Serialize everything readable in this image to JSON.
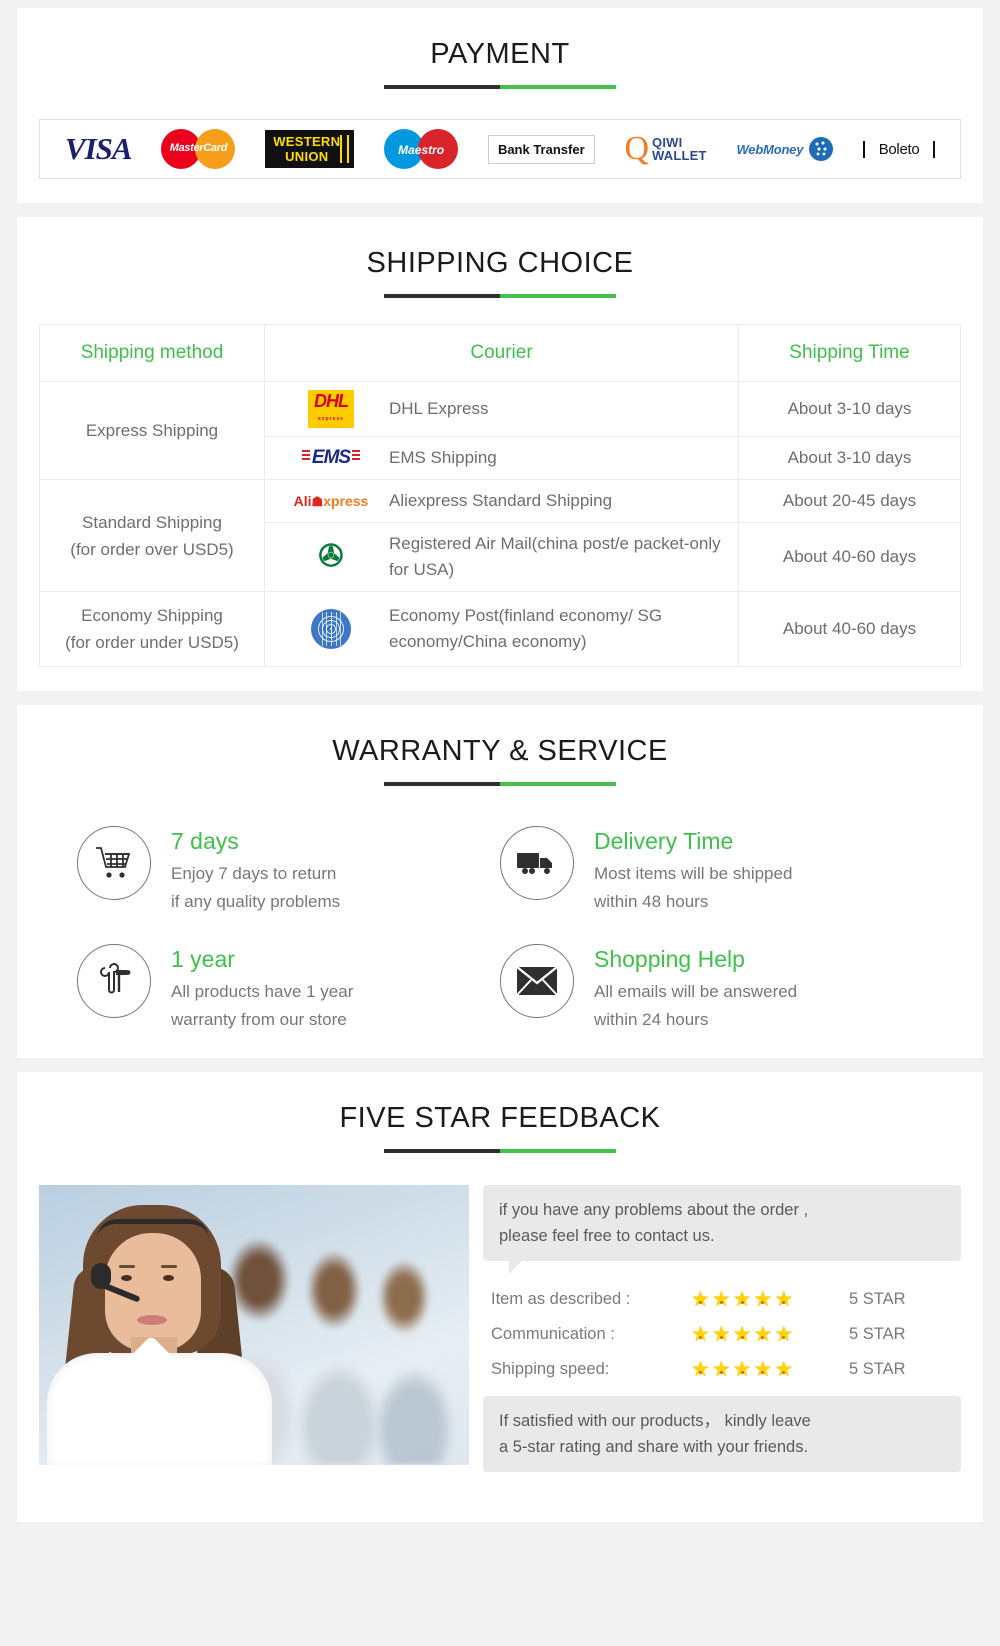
{
  "payment": {
    "title": "PAYMENT",
    "methods": [
      {
        "name": "visa",
        "label": "VISA"
      },
      {
        "name": "mastercard",
        "label": "MasterCard"
      },
      {
        "name": "western-union",
        "line1": "WESTERN",
        "line2": "UNION"
      },
      {
        "name": "maestro",
        "label": "Maestro"
      },
      {
        "name": "bank-transfer",
        "label": "Bank Transfer"
      },
      {
        "name": "qiwi-wallet",
        "line1": "QIWI",
        "line2": "WALLET"
      },
      {
        "name": "webmoney",
        "label": "WebMoney"
      },
      {
        "name": "boleto",
        "label": "Boleto"
      }
    ]
  },
  "shipping": {
    "title": "SHIPPING CHOICE",
    "headers": [
      "Shipping method",
      "Courier",
      "Shipping Time"
    ],
    "groups": [
      {
        "method": "Express Shipping",
        "rows": [
          {
            "logo": "dhl",
            "courier": "DHL Express",
            "time": "About 3-10 days"
          },
          {
            "logo": "ems",
            "courier": "EMS Shipping",
            "time": "About 3-10 days"
          }
        ]
      },
      {
        "method_line1": "Standard Shipping",
        "method_line2": "(for order over USD5)",
        "rows": [
          {
            "logo": "aliexpress",
            "courier": "Aliexpress Standard Shipping",
            "time": "About 20-45 days"
          },
          {
            "logo": "china-post",
            "courier": "Registered Air Mail(china post/e packet-only for USA)",
            "time": "About 40-60 days"
          }
        ]
      },
      {
        "method_line1": "Economy Shipping",
        "method_line2": "(for order under USD5)",
        "rows": [
          {
            "logo": "un-post",
            "courier": "Economy Post(finland economy/ SG economy/China economy)",
            "time": "About 40-60 days"
          }
        ]
      }
    ],
    "logos": {
      "dhl": "DHL",
      "dhl_sub": "express",
      "ems": "EMS",
      "ali_a": "Ali",
      "ali_cart": "☗",
      "ali_x": "xpress",
      "china_post": "✇"
    }
  },
  "warranty": {
    "title": "WARRANTY & SERVICE",
    "items": [
      {
        "icon": "shopping-cart-icon",
        "title": "7 days",
        "line1": "Enjoy 7 days to return",
        "line2": "if any quality problems"
      },
      {
        "icon": "delivery-truck-icon",
        "title": "Delivery Time",
        "line1": "Most items will be shipped",
        "line2": "within 48 hours"
      },
      {
        "icon": "tools-icon",
        "title": "1  year",
        "line1": "All products have 1 year",
        "line2": "warranty from our store"
      },
      {
        "icon": "envelope-icon",
        "title": "Shopping Help",
        "line1": "All emails will be answered",
        "line2": "within 24 hours"
      }
    ]
  },
  "feedback": {
    "title": "FIVE STAR FEEDBACK",
    "bubble_top_line1": "if you have any problems about the order ,",
    "bubble_top_line2": "please feel free to contact us.",
    "ratings": [
      {
        "label": "Item as described :",
        "stars": 5,
        "value": "5 STAR"
      },
      {
        "label": "Communication :",
        "stars": 5,
        "value": "5 STAR"
      },
      {
        "label": "Shipping speed:",
        "stars": 5,
        "value": "5 STAR"
      }
    ],
    "bubble_bottom_line1": "If satisfied with our products， kindly leave",
    "bubble_bottom_line2": "a 5-star rating and share with your friends.",
    "star_glyph": "★",
    "photo_alt": "customer-service-agent-photo"
  },
  "colors": {
    "green": "#3fc04a",
    "dark_rule": "#2e2e2e",
    "text_gray": "#6e6e6e"
  }
}
